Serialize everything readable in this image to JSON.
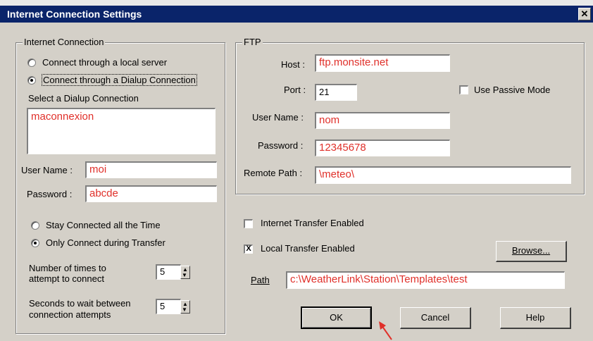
{
  "window": {
    "title": "Internet Connection Settings",
    "close_glyph": "✕"
  },
  "internet_connection": {
    "legend": "Internet Connection",
    "radio_local": "Connect through a local server",
    "radio_dialup": "Connect through a Dialup Connection",
    "select_label": "Select a Dialup Connection",
    "dialup_value": "maconnexion",
    "username_label": "User Name :",
    "username_value": "moi",
    "password_label": "Password :",
    "password_value": "abcde",
    "stay_connected": "Stay Connected all the Time",
    "only_connect": "Only Connect during Transfer",
    "attempts_label_1": "Number of times to",
    "attempts_label_2": "attempt to connect",
    "attempts_value": "5",
    "wait_label_1": "Seconds to wait between",
    "wait_label_2": "connection attempts",
    "wait_value": "5"
  },
  "ftp": {
    "legend": "FTP",
    "host_label": "Host :",
    "host_value": "ftp.monsite.net",
    "port_label": "Port :",
    "port_value": "21",
    "passive_label": "Use Passive Mode",
    "username_label": "User Name :",
    "username_value": "nom",
    "password_label": "Password :",
    "password_value": "12345678",
    "remote_label": "Remote Path :",
    "remote_value": "\\meteo\\"
  },
  "transfer": {
    "internet_enabled": "Internet Transfer Enabled",
    "local_enabled": "Local Transfer Enabled",
    "local_checked_glyph": "X",
    "browse_label": "Browse...",
    "path_label": "Path",
    "path_value": "c:\\WeatherLink\\Station\\Templates\\test"
  },
  "buttons": {
    "ok": "OK",
    "cancel": "Cancel",
    "help": "Help"
  },
  "spin_glyphs": {
    "up": "▲",
    "down": "▼"
  },
  "colors": {
    "title_bar": "#0a246a",
    "field_text": "#e0302a",
    "arrow": "#e0302a",
    "dialog_bg": "#d4d0c8"
  }
}
